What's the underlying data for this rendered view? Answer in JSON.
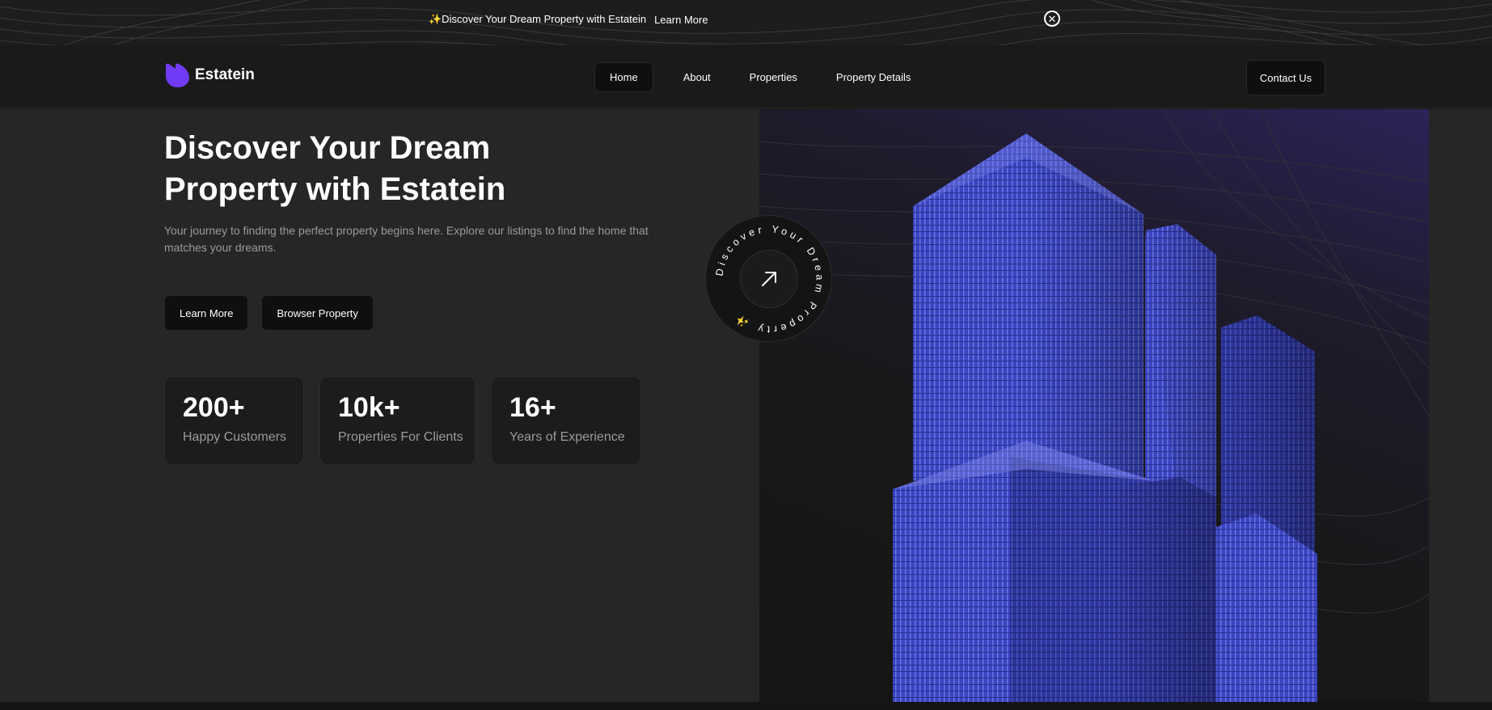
{
  "announcement": {
    "text": "✨Discover Your Dream Property with Estatein",
    "link": "Learn More",
    "close_icon": "close-circle-icon"
  },
  "header": {
    "logo_text": "Estatein",
    "logo_icon": "estatein-logo-icon",
    "nav": [
      "Home",
      "About",
      "Properties",
      "Property Details"
    ],
    "active_nav": "Home",
    "contact": "Contact Us"
  },
  "hero": {
    "title_line1": "Discover Your Dream",
    "title_line2": "Property with Estatein",
    "subtitle": "Your journey to finding the perfect property begins here. Explore our listings to find the home that matches your dreams.",
    "buttons": [
      "Learn More",
      "Browser Property"
    ],
    "stats": [
      {
        "value": "200+",
        "label": "Happy Customers"
      },
      {
        "value": "10k+",
        "label": "Properties For Clients"
      },
      {
        "value": "16+",
        "label": "Years of Experience"
      }
    ]
  },
  "badge": {
    "circular_text": "Discover Your Dream Property ✨",
    "icon": "arrow-up-right-icon"
  },
  "colors": {
    "accent": "#703bf7",
    "background": "#1a1a1a",
    "panel": "#262626",
    "building": "#3b47c8"
  }
}
